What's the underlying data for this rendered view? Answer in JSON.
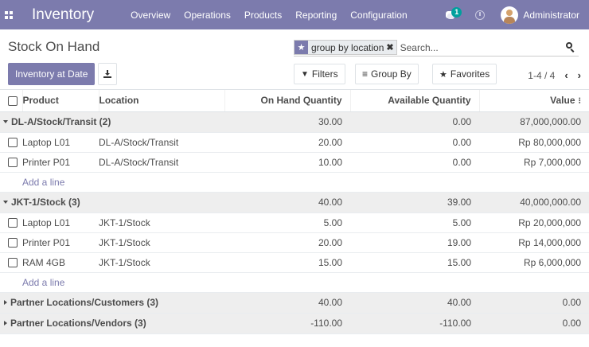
{
  "navbar": {
    "app_name": "Inventory",
    "menu": [
      "Overview",
      "Operations",
      "Products",
      "Reporting",
      "Configuration"
    ],
    "chat_badge": "1",
    "user": "Administrator"
  },
  "control_panel": {
    "title": "Stock On Hand",
    "inventory_at_date_label": "Inventory at Date",
    "search": {
      "facet_label": "group by location",
      "facet_remove": "✖",
      "placeholder": "Search..."
    },
    "filters_label": "Filters",
    "groupby_label": "Group By",
    "favorites_label": "Favorites",
    "pager": "1-4 / 4"
  },
  "table": {
    "headers": {
      "product": "Product",
      "location": "Location",
      "on_hand": "On Hand Quantity",
      "available": "Available Quantity",
      "value": "Value"
    },
    "add_line_label": "Add a line",
    "groups": [
      {
        "label": "DL-A/Stock/Transit (2)",
        "on_hand": "30.00",
        "available": "0.00",
        "value": "87,000,000.00",
        "rows": [
          {
            "product": "Laptop L01",
            "location": "DL-A/Stock/Transit",
            "on_hand": "20.00",
            "available": "0.00",
            "value": "Rp 80,000,000"
          },
          {
            "product": "Printer P01",
            "location": "DL-A/Stock/Transit",
            "on_hand": "10.00",
            "available": "0.00",
            "value": "Rp 7,000,000"
          }
        ]
      },
      {
        "label": "JKT-1/Stock (3)",
        "on_hand": "40.00",
        "available": "39.00",
        "value": "40,000,000.00",
        "rows": [
          {
            "product": "Laptop L01",
            "location": "JKT-1/Stock",
            "on_hand": "5.00",
            "available": "5.00",
            "value": "Rp 20,000,000"
          },
          {
            "product": "Printer P01",
            "location": "JKT-1/Stock",
            "on_hand": "20.00",
            "available": "19.00",
            "value": "Rp 14,000,000"
          },
          {
            "product": "RAM 4GB",
            "location": "JKT-1/Stock",
            "on_hand": "15.00",
            "available": "15.00",
            "value": "Rp 6,000,000"
          }
        ]
      },
      {
        "label": "Partner Locations/Customers (3)",
        "on_hand": "40.00",
        "available": "40.00",
        "value": "0.00"
      },
      {
        "label": "Partner Locations/Vendors (3)",
        "on_hand": "-110.00",
        "available": "-110.00",
        "value": "0.00"
      }
    ]
  }
}
